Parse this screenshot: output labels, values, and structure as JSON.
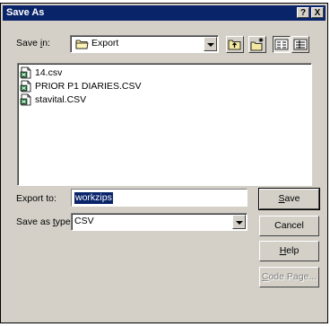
{
  "window": {
    "title": "Save As",
    "help_glyph": "?",
    "close_glyph": "X"
  },
  "save_in": {
    "label_pre": "Save ",
    "label_key": "i",
    "label_post": "n:",
    "value": "Export",
    "icon": "folder-icon"
  },
  "toolbar": {
    "up_icon": "up-one-level-icon",
    "new_folder_icon": "new-folder-icon",
    "list_view_icon": "list-view-icon",
    "details_view_icon": "details-view-icon"
  },
  "files": [
    {
      "name": "14.csv",
      "icon": "excel-csv-icon"
    },
    {
      "name": "PRIOR P1 DIARIES.CSV",
      "icon": "excel-csv-icon"
    },
    {
      "name": "stavital.CSV",
      "icon": "excel-csv-icon"
    }
  ],
  "export_to": {
    "label": "Export to:",
    "value": "workzips"
  },
  "save_as_type": {
    "label_pre": "Save as ",
    "label_key": "t",
    "label_post": "ype:",
    "value": "CSV"
  },
  "buttons": {
    "save_key": "S",
    "save_rest": "ave",
    "cancel": "Cancel",
    "help_key": "H",
    "help_rest": "elp",
    "code_page_key": "C",
    "code_page_rest": "ode Page..."
  },
  "colors": {
    "titlebar": "#0a246a",
    "face": "#d4d0c8",
    "selection": "#0a246a"
  }
}
